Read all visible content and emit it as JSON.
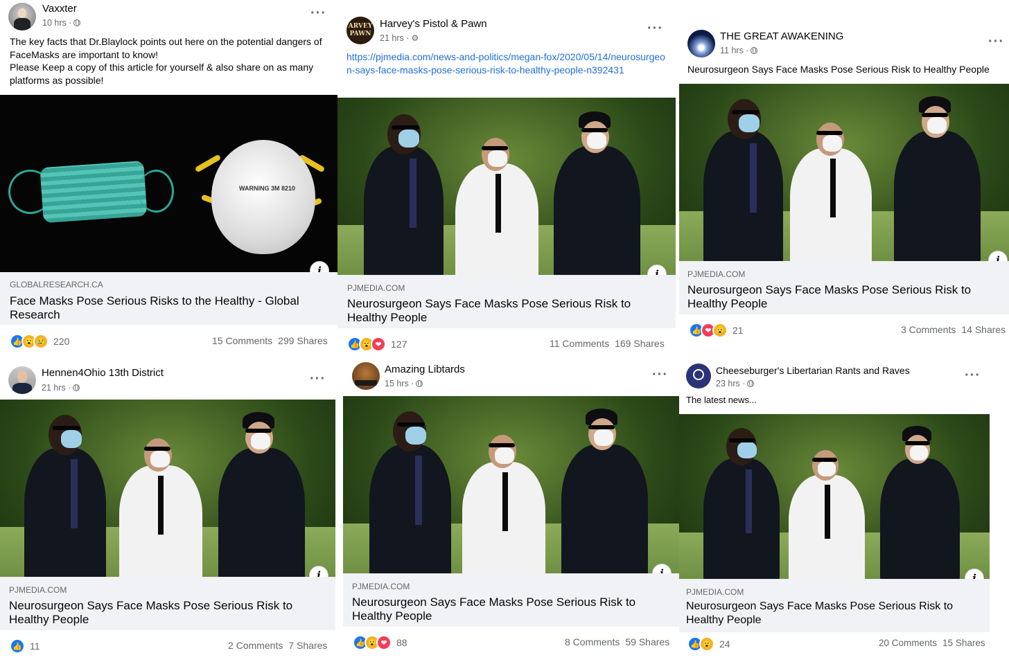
{
  "posts": [
    {
      "author": "Vaxxter",
      "time": "10 hrs ·",
      "text": "The key facts that Dr.Blaylock points out here on the potential dangers of FaceMasks are important to know!\nPlease Keep a copy of this article for yourself & also share on as many platforms as possible!",
      "domain": "GLOBALRESEARCH.CA",
      "title": "Face Masks Pose Serious Risks to the Healthy - Global Research",
      "reaction_count": "220",
      "comments": "15 Comments",
      "shares": "299 Shares",
      "reactions": [
        "like",
        "wow",
        "sad"
      ],
      "image": "face-masks"
    },
    {
      "author": "Harvey's Pistol & Pawn",
      "time": "21 hrs ·",
      "link": "https://pjmedia.com/news-and-politics/megan-fox/2020/05/14/neurosurgeon-says-face-masks-pose-serious-risk-to-healthy-people-n392431",
      "domain": "PJMEDIA.COM",
      "title": "Neurosurgeon Says Face Masks Pose Serious Risk to Healthy People",
      "reaction_count": "127",
      "comments": "11 Comments",
      "shares": "169 Shares",
      "reactions": [
        "like",
        "wow",
        "love"
      ],
      "image": "guards"
    },
    {
      "author": "THE GREAT AWAKENING",
      "time": "11 hrs ·",
      "text": "Neurosurgeon Says Face Masks Pose Serious Risk to Healthy People",
      "domain": "PJMEDIA.COM",
      "title": "Neurosurgeon Says Face Masks Pose Serious Risk to Healthy People",
      "reaction_count": "21",
      "comments": "3 Comments",
      "shares": "14 Shares",
      "reactions": [
        "like",
        "love",
        "wow"
      ],
      "image": "guards"
    },
    {
      "author": "Hennen4Ohio 13th District",
      "time": "21 hrs ·",
      "domain": "PJMEDIA.COM",
      "title": "Neurosurgeon Says Face Masks Pose Serious Risk to Healthy People",
      "reaction_count": "11",
      "comments": "2 Comments",
      "shares": "7 Shares",
      "reactions": [
        "like"
      ],
      "image": "guards"
    },
    {
      "author": "Amazing Libtards",
      "time": "15 hrs ·",
      "domain": "PJMEDIA.COM",
      "title": "Neurosurgeon Says Face Masks Pose Serious Risk to Healthy People",
      "reaction_count": "88",
      "comments": "8 Comments",
      "shares": "59 Shares",
      "reactions": [
        "like",
        "wow",
        "love"
      ],
      "image": "guards"
    },
    {
      "author": "Cheeseburger's Libertarian Rants and Raves",
      "time": "23 hrs ·",
      "text": "The latest news...",
      "domain": "PJMEDIA.COM",
      "title": "Neurosurgeon Says Face Masks Pose Serious Risk to Healthy People",
      "reaction_count": "24",
      "comments": "20 Comments",
      "shares": "15 Shares",
      "reactions": [
        "like",
        "wow"
      ],
      "image": "guards"
    }
  ],
  "avatar_label_2": "ARVEY PAWN",
  "n95_label": "WARNING 3M 8210",
  "colors": {
    "link": "#216fdb",
    "like": "#1877f2",
    "love": "#f33e58",
    "wow": "#f7b125",
    "secondary_text": "#65676b",
    "linkbox": "#f0f2f5"
  }
}
